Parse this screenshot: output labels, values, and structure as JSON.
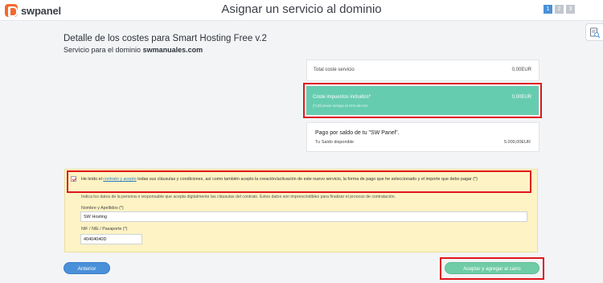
{
  "app": {
    "logo_text": "swpanel",
    "page_title": "Asignar un servicio al dominio"
  },
  "steps": [
    "1",
    "2",
    "3"
  ],
  "summary": {
    "heading": "Detalle de los costes para Smart Hosting Free v.2",
    "subheading_prefix": "Servicio para el dominio ",
    "domain": "swmanuales.com"
  },
  "costs": {
    "total_label": "Total coste servicio",
    "total_value": "0,00EUR",
    "tax_label": "Coste impuestos incluidos*",
    "tax_value": "0,00EUR",
    "tax_note": "(*) El precio incluye el 21% de IVA."
  },
  "payment": {
    "title": "Pago por saldo de tu \"SW Panel\".",
    "balance_label": "Tu Saldo disponible",
    "balance_value": "5.000,00EUR"
  },
  "terms": {
    "text_before": "He leído el ",
    "link": "contrato y acepto",
    "text_after": " todas sus cláusulas y condiciones, así como también acepto la creación/activación de este nuevo servicio, la forma de pago que he seleccionado y el importe que debo pagar (*)",
    "info": "Indica los datos de la persona o responsable que acepta digitalmente las cláusulas del contrato. Estos datos son imprescindibles para finalizar el proceso de contratación."
  },
  "form": {
    "name_label": "Nombre y Apellidos (*)",
    "name_value": "SW Hosting",
    "nif_label": "NIF / NIE / Pasaporte (*)",
    "nif_value": "40404040D"
  },
  "buttons": {
    "back": "Anterior",
    "accept": "Aceptar y agregar al carro"
  },
  "icons": {
    "logo": "swpanel-logo-icon",
    "side_tool": "search-document-icon",
    "check": "checkmark-icon"
  },
  "colors": {
    "brand": "#f26a2e",
    "primary": "#4a90d9",
    "tax_box": "#66ccb0",
    "accept": "#6fcca6",
    "highlight": "#e0161b",
    "terms_bg": "#fdf3c4"
  }
}
